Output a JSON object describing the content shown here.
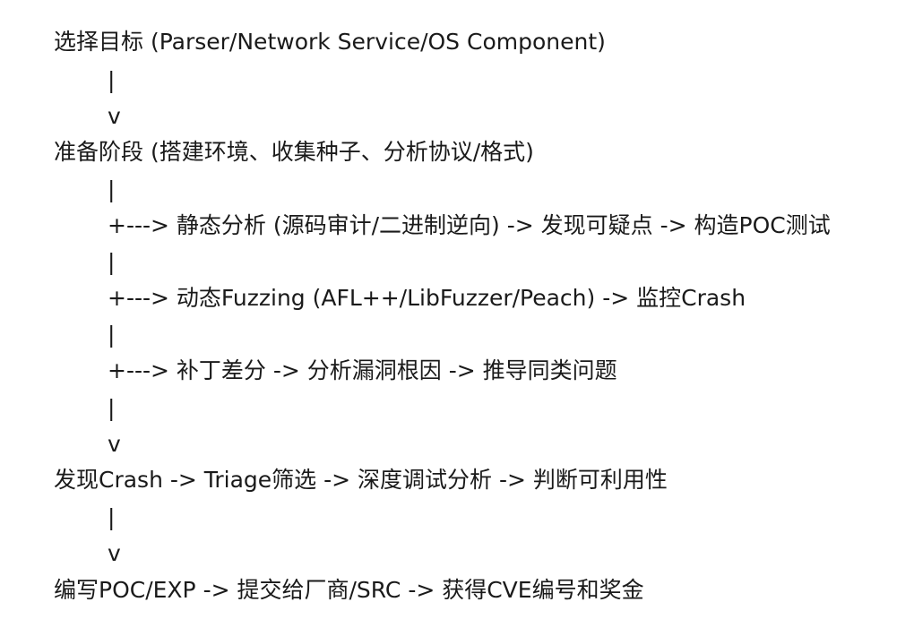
{
  "flow": {
    "lines": [
      "选择目标 (Parser/Network Service/OS Component)",
      "|",
      "v",
      "准备阶段 (搭建环境、收集种子、分析协议/格式)",
      "|",
      "+---> 静态分析 (源码审计/二进制逆向) -> 发现可疑点 -> 构造POC测试",
      "|",
      "+---> 动态Fuzzing (AFL++/LibFuzzer/Peach) -> 监控Crash",
      "|",
      "+---> 补丁差分 -> 分析漏洞根因 -> 推导同类问题",
      "|",
      "v",
      "发现Crash -> Triage筛选 -> 深度调试分析 -> 判断可利用性",
      "|",
      "v",
      "编写POC/EXP -> 提交给厂商/SRC -> 获得CVE编号和奖金"
    ]
  }
}
